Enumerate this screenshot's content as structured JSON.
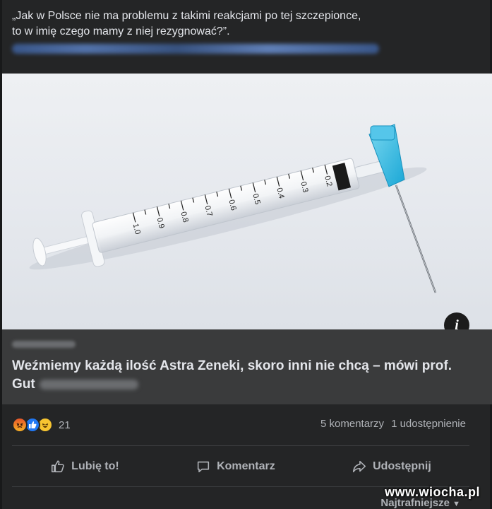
{
  "post": {
    "text_line1": "„Jak w Polsce nie ma problemu z takimi reakcjami po tej szczepionce,",
    "text_line2": "to w imię czego mamy z niej rezygnować?”."
  },
  "link": {
    "title": "Weźmiemy każdą ilość Astra Zeneki, skoro inni nie chcą – mówi prof. Gut",
    "info_icon": "i",
    "syringe_labels": [
      "0.2",
      "0.3",
      "0.4",
      "0.5",
      "0.6",
      "0.7",
      "0.8",
      "0.9",
      "1.0"
    ]
  },
  "reactions": {
    "icons": [
      "angry-reaction-icon",
      "like-reaction-icon",
      "haha-reaction-icon"
    ],
    "count": "21"
  },
  "stats": {
    "comments": "5 komentarzy",
    "shares": "1 udostępnienie"
  },
  "actions": {
    "like": "Lubię to!",
    "comment": "Komentarz",
    "share": "Udostępnij"
  },
  "sort": {
    "label": "Najtrafniejsze"
  },
  "watermark": "www.wiocha.pl",
  "colors": {
    "background": "#242526",
    "link_meta_bg": "#3a3b3c",
    "secondary_text": "#b0b3b8",
    "like_blue": "#2078f4"
  }
}
